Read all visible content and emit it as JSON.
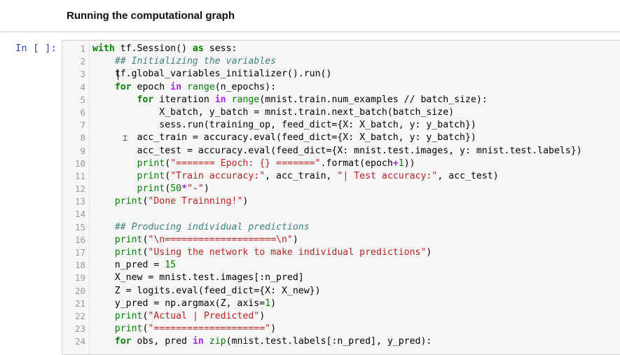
{
  "notebook": {
    "heading": "Running the computational graph",
    "prompt": "In [ ]:"
  },
  "code_lines": [
    {
      "n": "1",
      "segs": [
        {
          "t": "with",
          "c": "kw"
        },
        {
          "t": " tf.Session() "
        },
        {
          "t": "as",
          "c": "kw"
        },
        {
          "t": " sess:"
        }
      ]
    },
    {
      "n": "2",
      "segs": [
        {
          "t": "    "
        },
        {
          "t": "## Initializing the variables",
          "c": "cmt"
        }
      ]
    },
    {
      "n": "3",
      "segs": [
        {
          "t": "    tf.global_variables_initializer().run()"
        }
      ]
    },
    {
      "n": "4",
      "segs": [
        {
          "t": "    "
        },
        {
          "t": "for",
          "c": "kw"
        },
        {
          "t": " epoch "
        },
        {
          "t": "in",
          "c": "op"
        },
        {
          "t": " "
        },
        {
          "t": "range",
          "c": "bi"
        },
        {
          "t": "(n_epochs):"
        }
      ]
    },
    {
      "n": "5",
      "segs": [
        {
          "t": "        "
        },
        {
          "t": "for",
          "c": "kw"
        },
        {
          "t": " iteration "
        },
        {
          "t": "in",
          "c": "op"
        },
        {
          "t": " "
        },
        {
          "t": "range",
          "c": "bi"
        },
        {
          "t": "(mnist.train.num_examples // batch_size):"
        }
      ]
    },
    {
      "n": "6",
      "segs": [
        {
          "t": "            X_batch, y_batch = mnist.train.next_batch(batch_size)"
        }
      ]
    },
    {
      "n": "7",
      "segs": [
        {
          "t": "            sess.run(training_op, feed_dict={X: X_batch, y: y_batch})"
        }
      ]
    },
    {
      "n": "8",
      "segs": [
        {
          "t": "        acc_train = accuracy.eval(feed_dict={X: X_batch, y: y_batch})"
        }
      ]
    },
    {
      "n": "9",
      "segs": [
        {
          "t": "        acc_test = accuracy.eval(feed_dict={X: mnist.test.images, y: mnist.test.labels})"
        }
      ]
    },
    {
      "n": "10",
      "segs": [
        {
          "t": "        "
        },
        {
          "t": "print",
          "c": "bi"
        },
        {
          "t": "("
        },
        {
          "t": "\"======= Epoch: {} =======\"",
          "c": "str"
        },
        {
          "t": ".format(epoch"
        },
        {
          "t": "+",
          "c": "op"
        },
        {
          "t": "1",
          "c": "num"
        },
        {
          "t": "))"
        }
      ]
    },
    {
      "n": "11",
      "segs": [
        {
          "t": "        "
        },
        {
          "t": "print",
          "c": "bi"
        },
        {
          "t": "("
        },
        {
          "t": "\"Train accuracy:\"",
          "c": "str"
        },
        {
          "t": ", acc_train, "
        },
        {
          "t": "\"| Test accuracy:\"",
          "c": "str"
        },
        {
          "t": ", acc_test)"
        }
      ]
    },
    {
      "n": "12",
      "segs": [
        {
          "t": "        "
        },
        {
          "t": "print",
          "c": "bi"
        },
        {
          "t": "("
        },
        {
          "t": "50",
          "c": "num"
        },
        {
          "t": "*",
          "c": "op"
        },
        {
          "t": "\"-\"",
          "c": "str"
        },
        {
          "t": ")"
        }
      ]
    },
    {
      "n": "13",
      "segs": [
        {
          "t": "    "
        },
        {
          "t": "print",
          "c": "bi"
        },
        {
          "t": "("
        },
        {
          "t": "\"Done Trainning!\"",
          "c": "str"
        },
        {
          "t": ")"
        }
      ]
    },
    {
      "n": "14",
      "segs": []
    },
    {
      "n": "15",
      "segs": [
        {
          "t": "    "
        },
        {
          "t": "## Producing individual predictions",
          "c": "cmt"
        }
      ]
    },
    {
      "n": "16",
      "segs": [
        {
          "t": "    "
        },
        {
          "t": "print",
          "c": "bi"
        },
        {
          "t": "("
        },
        {
          "t": "\"\\n====================\\n\"",
          "c": "str"
        },
        {
          "t": ")"
        }
      ]
    },
    {
      "n": "17",
      "segs": [
        {
          "t": "    "
        },
        {
          "t": "print",
          "c": "bi"
        },
        {
          "t": "("
        },
        {
          "t": "\"Using the network to make individual predictions\"",
          "c": "str"
        },
        {
          "t": ")"
        }
      ]
    },
    {
      "n": "18",
      "segs": [
        {
          "t": "    n_pred = "
        },
        {
          "t": "15",
          "c": "num"
        }
      ]
    },
    {
      "n": "19",
      "segs": [
        {
          "t": "    X_new = mnist.test.images[:n_pred]"
        }
      ]
    },
    {
      "n": "20",
      "segs": [
        {
          "t": "    Z = logits.eval(feed_dict={X: X_new})"
        }
      ]
    },
    {
      "n": "21",
      "segs": [
        {
          "t": "    y_pred = np.argmax(Z, axis="
        },
        {
          "t": "1",
          "c": "num"
        },
        {
          "t": ")"
        }
      ]
    },
    {
      "n": "22",
      "segs": [
        {
          "t": "    "
        },
        {
          "t": "print",
          "c": "bi"
        },
        {
          "t": "("
        },
        {
          "t": "\"Actual | Predicted\"",
          "c": "str"
        },
        {
          "t": ")"
        }
      ]
    },
    {
      "n": "23",
      "segs": [
        {
          "t": "    "
        },
        {
          "t": "print",
          "c": "bi"
        },
        {
          "t": "("
        },
        {
          "t": "\"====================\"",
          "c": "str"
        },
        {
          "t": ")"
        }
      ]
    },
    {
      "n": "24",
      "segs": [
        {
          "t": "    "
        },
        {
          "t": "for",
          "c": "kw"
        },
        {
          "t": " obs, pred "
        },
        {
          "t": "in",
          "c": "op"
        },
        {
          "t": " "
        },
        {
          "t": "zip",
          "c": "bi"
        },
        {
          "t": "(mnist.test.labels[:n_pred], y_pred):"
        }
      ]
    }
  ],
  "colors": {
    "keyword": "#008000",
    "string": "#ba2121",
    "comment": "#408080",
    "operator": "#aa22ff",
    "prompt": "#303f9f",
    "cell_background": "#f7f7f7"
  }
}
